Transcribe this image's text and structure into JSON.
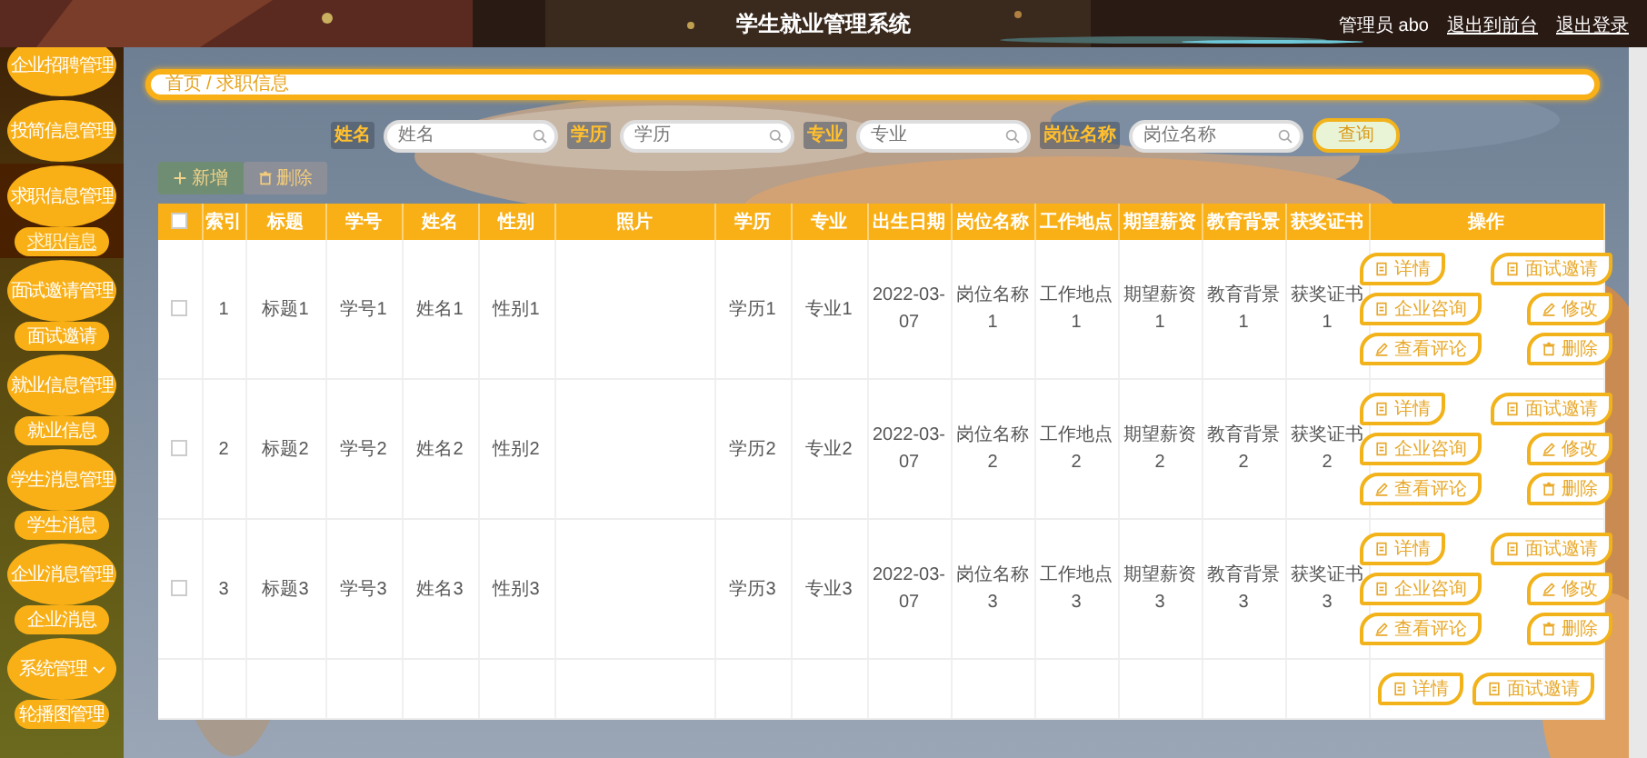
{
  "header": {
    "title": "学生就业管理系统",
    "user": "管理员 abo",
    "links": [
      "退出到前台",
      "退出登录"
    ]
  },
  "sidebar": {
    "items": [
      {
        "label": "企业招聘管理",
        "kind": "link"
      },
      {
        "label": "投简信息管理",
        "kind": "link"
      },
      {
        "label": "求职信息管理",
        "kind": "link",
        "children": [
          {
            "label": "求职信息",
            "selected": true
          }
        ]
      },
      {
        "label": "面试邀请管理",
        "kind": "link",
        "children": [
          {
            "label": "面试邀请",
            "selected": false
          }
        ]
      },
      {
        "label": "就业信息管理",
        "kind": "link",
        "children": [
          {
            "label": "就业信息",
            "selected": false
          }
        ]
      },
      {
        "label": "学生消息管理",
        "kind": "link",
        "children": [
          {
            "label": "学生消息",
            "selected": false
          }
        ]
      },
      {
        "label": "企业消息管理",
        "kind": "link",
        "children": [
          {
            "label": "企业消息",
            "selected": false
          }
        ]
      },
      {
        "label": "系统管理",
        "kind": "group",
        "children": [
          {
            "label": "轮播图管理",
            "selected": false
          }
        ]
      }
    ]
  },
  "breadcrumb": {
    "items": [
      "首页",
      "求职信息"
    ],
    "separator": "/"
  },
  "search": {
    "fields": [
      {
        "label": "姓名",
        "placeholder": "姓名"
      },
      {
        "label": "学历",
        "placeholder": "学历"
      },
      {
        "label": "专业",
        "placeholder": "专业"
      },
      {
        "label": "岗位名称",
        "placeholder": "岗位名称"
      }
    ],
    "button": "查询"
  },
  "toolbar": [
    {
      "kind": "add",
      "label": "新增"
    },
    {
      "kind": "delete",
      "label": "删除"
    }
  ],
  "table": {
    "columns": [
      {
        "kind": "check",
        "checked": false
      },
      {
        "label": "索引"
      },
      {
        "label": "标题"
      },
      {
        "label": "学号"
      },
      {
        "label": "姓名"
      },
      {
        "label": "性别"
      },
      {
        "label": "照片"
      },
      {
        "label": "学历"
      },
      {
        "label": "专业"
      },
      {
        "label": "出生日期"
      },
      {
        "label": "岗位名称"
      },
      {
        "label": "工作地点"
      },
      {
        "label": "期望薪资"
      },
      {
        "label": "教育背景"
      },
      {
        "label": "获奖证书"
      },
      {
        "label": "操作",
        "kind": "actions"
      }
    ],
    "rows": [
      {
        "checked": false,
        "cells": [
          "1",
          "标题1",
          "学号1",
          "姓名1",
          "性别1",
          "学历1",
          "专业1",
          "2022-03-07",
          "岗位名称1",
          "工作地点1",
          "期望薪资1",
          "教育背景1",
          "获奖证书1"
        ],
        "actions": [
          {
            "kind": "doc",
            "label": "详情"
          },
          {
            "kind": "doc",
            "label": "面试邀请"
          },
          {
            "kind": "doc",
            "label": "企业咨询"
          },
          {
            "kind": "edit",
            "label": "修改"
          },
          {
            "kind": "edit",
            "label": "查看评论"
          },
          {
            "kind": "delete",
            "label": "删除"
          }
        ]
      },
      {
        "checked": false,
        "cells": [
          "2",
          "标题2",
          "学号2",
          "姓名2",
          "性别2",
          "学历2",
          "专业2",
          "2022-03-07",
          "岗位名称2",
          "工作地点2",
          "期望薪资2",
          "教育背景2",
          "获奖证书2"
        ],
        "actions": [
          {
            "kind": "doc",
            "label": "详情"
          },
          {
            "kind": "doc",
            "label": "面试邀请"
          },
          {
            "kind": "doc",
            "label": "企业咨询"
          },
          {
            "kind": "edit",
            "label": "修改"
          },
          {
            "kind": "edit",
            "label": "查看评论"
          },
          {
            "kind": "delete",
            "label": "删除"
          }
        ]
      },
      {
        "checked": false,
        "cells": [
          "3",
          "标题3",
          "学号3",
          "姓名3",
          "性别3",
          "学历3",
          "专业3",
          "2022-03-07",
          "岗位名称3",
          "工作地点3",
          "期望薪资3",
          "教育背景3",
          "获奖证书3"
        ],
        "actions": [
          {
            "kind": "doc",
            "label": "详情"
          },
          {
            "kind": "doc",
            "label": "面试邀请"
          },
          {
            "kind": "doc",
            "label": "企业咨询"
          },
          {
            "kind": "edit",
            "label": "修改"
          },
          {
            "kind": "edit",
            "label": "查看评论"
          },
          {
            "kind": "delete",
            "label": "删除"
          }
        ]
      },
      {
        "actions": [
          {
            "kind": "doc",
            "label": "详情"
          },
          {
            "kind": "doc",
            "label": "面试邀请"
          }
        ]
      }
    ]
  }
}
